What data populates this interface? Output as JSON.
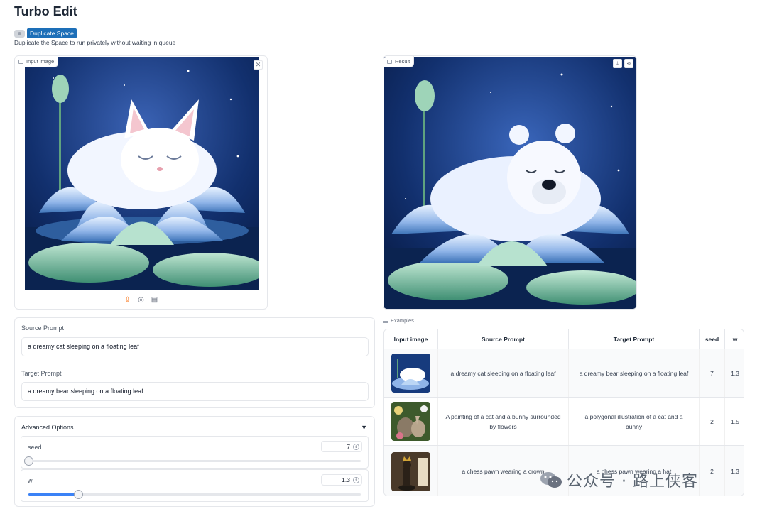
{
  "app": {
    "title": "Turbo Edit"
  },
  "duplicate": {
    "button_label": "Duplicate Space",
    "description": "Duplicate the Space to run privately without waiting in queue"
  },
  "input_panel": {
    "label": "Input image",
    "sources": [
      "upload-icon",
      "webcam-icon",
      "clipboard-icon"
    ]
  },
  "result_panel": {
    "label": "Result"
  },
  "prompts": {
    "source_label": "Source Prompt",
    "source_value": "a dreamy cat sleeping on a floating leaf",
    "target_label": "Target Prompt",
    "target_value": "a dreamy bear sleeping on a floating leaf"
  },
  "advanced": {
    "title": "Advanced Options",
    "arrow": "▼",
    "seed": {
      "label": "seed",
      "value": "7",
      "fraction": 0.0
    },
    "w": {
      "label": "w",
      "value": "1.3",
      "fraction": 0.15
    }
  },
  "examples": {
    "label": "Examples",
    "columns": [
      "Input image",
      "Source Prompt",
      "Target Prompt",
      "seed",
      "w"
    ],
    "rows": [
      {
        "source": "a dreamy cat sleeping on a floating leaf",
        "target": "a dreamy bear sleeping on a floating leaf",
        "seed": "7",
        "w": "1.3"
      },
      {
        "source": "A painting of a cat and a bunny surrounded by flowers",
        "target": "a polygonal illustration of a cat and a bunny",
        "seed": "2",
        "w": "1.5"
      },
      {
        "source": "a chess pawn wearing a crown",
        "target": "a chess pawn wearing a hat",
        "seed": "2",
        "w": "1.3"
      }
    ]
  },
  "watermark": {
    "text": "公众号 · 路上侠客"
  },
  "colors": {
    "accent": "#3b82f6",
    "duplicate_button": "#1d6fb8",
    "upload_active": "#f97316"
  }
}
